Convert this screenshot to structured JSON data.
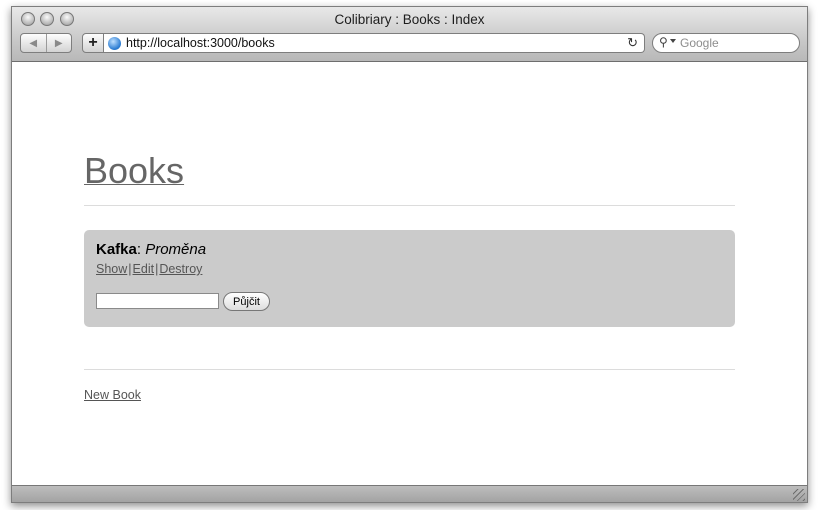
{
  "window": {
    "title": "Colibriary : Books : Index"
  },
  "toolbar": {
    "back_icon": "back-arrow-icon",
    "forward_icon": "forward-arrow-icon",
    "add_label": "+",
    "url": "http://localhost:3000/books",
    "reload_icon": "reload-icon",
    "search_placeholder": "Google"
  },
  "page": {
    "heading": "Books",
    "books": [
      {
        "author": "Kafka",
        "separator": ":",
        "title": "Proměna",
        "links": {
          "show": "Show",
          "edit": "Edit",
          "destroy": "Destroy",
          "divider": "|"
        },
        "borrow_button": "Půjčit",
        "borrow_value": ""
      }
    ],
    "new_book_link": "New Book"
  },
  "colors": {
    "card_background": "#cbcbcb",
    "link": "#555555",
    "heading": "#666666"
  }
}
